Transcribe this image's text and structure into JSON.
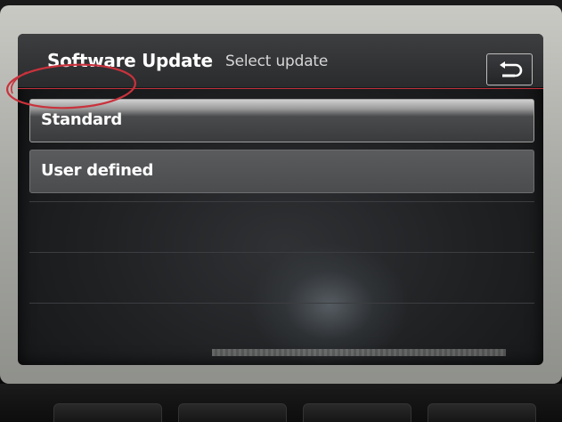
{
  "screen": {
    "header": {
      "title": "Software Update",
      "subtitle": "Select update",
      "back_icon": "return-arrow-icon"
    },
    "options": [
      {
        "label": "Standard",
        "selected": true
      },
      {
        "label": "User defined",
        "selected": false
      }
    ],
    "colors": {
      "header_rule": "#c0303a",
      "annotation_circle": "#c9323c"
    }
  }
}
